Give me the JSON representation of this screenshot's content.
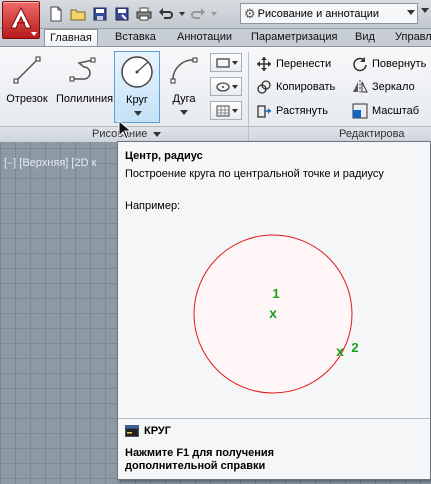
{
  "quick_access": {
    "workspace": "Рисование и аннотации",
    "icons": [
      "new-icon",
      "open-icon",
      "save-icon",
      "save-as-icon",
      "print-icon",
      "undo-icon",
      "redo-icon"
    ]
  },
  "tabs": [
    {
      "label": "Главная",
      "active": true
    },
    {
      "label": "Вставка"
    },
    {
      "label": "Аннотации"
    },
    {
      "label": "Параметризация"
    },
    {
      "label": "Вид"
    },
    {
      "label": "Управл"
    }
  ],
  "ribbon": {
    "draw": {
      "line": "Отрезок",
      "polyline": "Полилиния",
      "circle": "Круг",
      "arc": "Дуга",
      "panel_title": "Рисование"
    },
    "modify": {
      "move": "Перенести",
      "rotate": "Повернуть",
      "copy": "Копировать",
      "mirror": "Зеркало",
      "stretch": "Растянуть",
      "scale": "Масштаб",
      "panel_title": "Редактирова"
    }
  },
  "viewport": {
    "label": "[–] [Верхняя] [2D к"
  },
  "tooltip": {
    "title": "Центр, радиус",
    "description": "Построение круга по центральной точке и радиусу",
    "example_label": "Например:",
    "point1": "1",
    "point2": "2",
    "command": "КРУГ",
    "help": "Нажмите F1 для получения дополнительной справки"
  },
  "colors": {
    "circle_stroke": "#e0191b",
    "marker": "#1aa01a",
    "app_button": "#c9302c",
    "selected_button": "#c4e1f7"
  }
}
